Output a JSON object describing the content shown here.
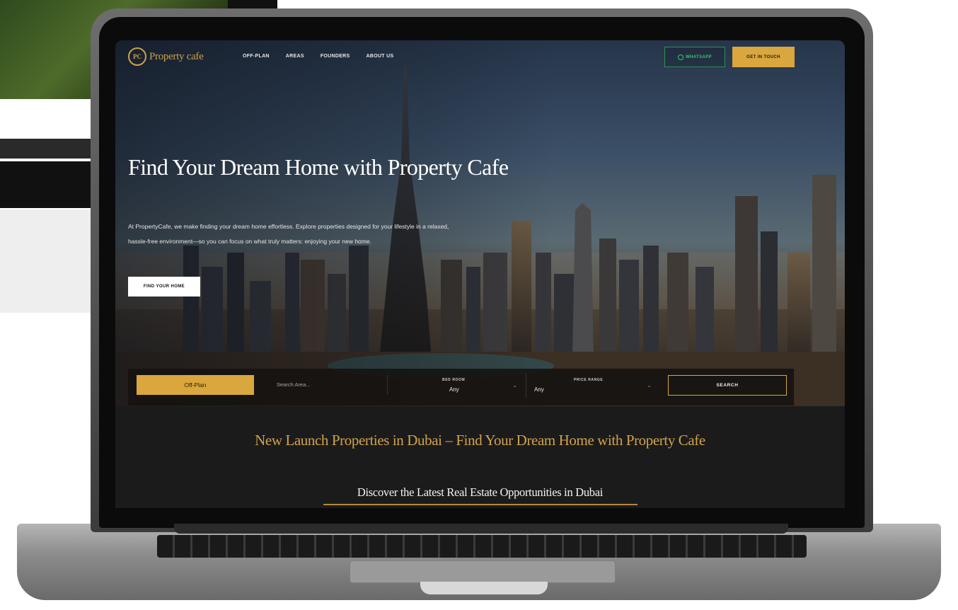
{
  "nav": {
    "logo_mark": "PC",
    "logo_text": "Property cafe",
    "links": [
      "OFF-PLAN",
      "AREAS",
      "FOUNDERS",
      "ABOUT US"
    ],
    "whatsapp_label": "WHATSAPP",
    "get_in_touch_label": "GET IN TOUCH"
  },
  "hero": {
    "title": "Find Your Dream Home with Property Cafe",
    "description": "At PropertyCafe, we make finding your dream home effortless. Explore properties designed for your lifestyle in a relaxed, hassle-free environment—so you can focus on what truly matters: enjoying your new home.",
    "cta_label": "FIND YOUR HOME"
  },
  "search": {
    "type_label": "Off-Plan",
    "area_placeholder": "Search Area...",
    "bedroom_label": "BED ROOM",
    "bedroom_value": "Any",
    "price_label": "PRICE RANGE",
    "price_value": "Any",
    "search_label": "SEARCH"
  },
  "section": {
    "title": "New Launch Properties in Dubai – Find Your Dream Home with Property Cafe",
    "subtitle": "Discover the Latest Real Estate Opportunities in Dubai"
  },
  "colors": {
    "gold": "#d9a73e",
    "whatsapp_green": "#3cc46e",
    "dark": "#1b1b1b"
  }
}
